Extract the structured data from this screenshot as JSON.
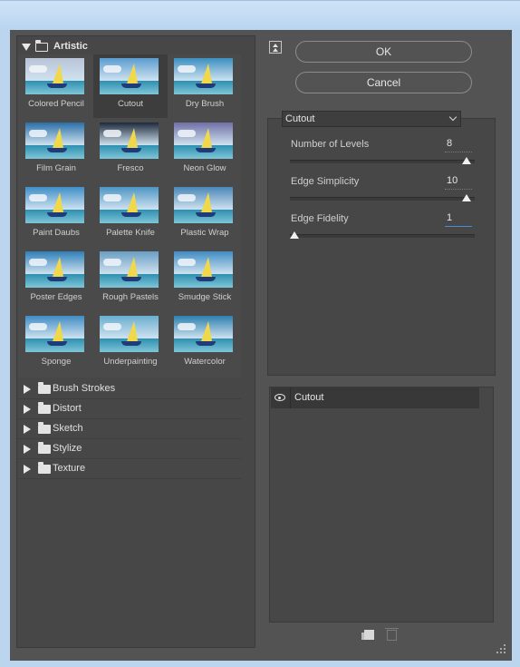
{
  "gallery": {
    "open_folder": {
      "label": "Artistic"
    },
    "filters": [
      {
        "caption": "Colored Pencil",
        "selected": false,
        "tint": "#b9c4d6"
      },
      {
        "caption": "Cutout",
        "selected": true,
        "tint": "#5a9cd0"
      },
      {
        "caption": "Dry Brush",
        "selected": false,
        "tint": "#3b8fc0"
      },
      {
        "caption": "Film Grain",
        "selected": false,
        "tint": "#2a6fa8"
      },
      {
        "caption": "Fresco",
        "selected": false,
        "tint": "#1e2a3c"
      },
      {
        "caption": "Neon Glow",
        "selected": false,
        "tint": "#6f6fa6"
      },
      {
        "caption": "Paint Daubs",
        "selected": false,
        "tint": "#3d8fc8"
      },
      {
        "caption": "Palette Knife",
        "selected": false,
        "tint": "#4c95c4"
      },
      {
        "caption": "Plastic Wrap",
        "selected": false,
        "tint": "#4a87b8"
      },
      {
        "caption": "Poster Edges",
        "selected": false,
        "tint": "#2f7fb8"
      },
      {
        "caption": "Rough Pastels",
        "selected": false,
        "tint": "#6a9ec4"
      },
      {
        "caption": "Smudge Stick",
        "selected": false,
        "tint": "#3f8cc4"
      },
      {
        "caption": "Sponge",
        "selected": false,
        "tint": "#3f8cc4"
      },
      {
        "caption": "Underpainting",
        "selected": false,
        "tint": "#6aaed0"
      },
      {
        "caption": "Watercolor",
        "selected": false,
        "tint": "#2c7fb0"
      }
    ],
    "folders": [
      {
        "label": "Brush Strokes"
      },
      {
        "label": "Distort"
      },
      {
        "label": "Sketch"
      },
      {
        "label": "Stylize"
      },
      {
        "label": "Texture"
      }
    ]
  },
  "buttons": {
    "ok": "OK",
    "cancel": "Cancel"
  },
  "filter_select": {
    "value": "Cutout"
  },
  "params": [
    {
      "label": "Number of Levels",
      "value": "8",
      "slider_fraction": 0.98
    },
    {
      "label": "Edge Simplicity",
      "value": "10",
      "slider_fraction": 0.98
    },
    {
      "label": "Edge Fidelity",
      "value": "1",
      "slider_fraction": 0.0
    }
  ],
  "layers": [
    {
      "name": "Cutout",
      "visible": true
    }
  ],
  "icons": {
    "collapse": "collapse-icon",
    "eye": "eye-icon",
    "new_layer": "new-effect-layer-icon",
    "delete": "trash-icon",
    "resize": "resize-grip-icon"
  }
}
